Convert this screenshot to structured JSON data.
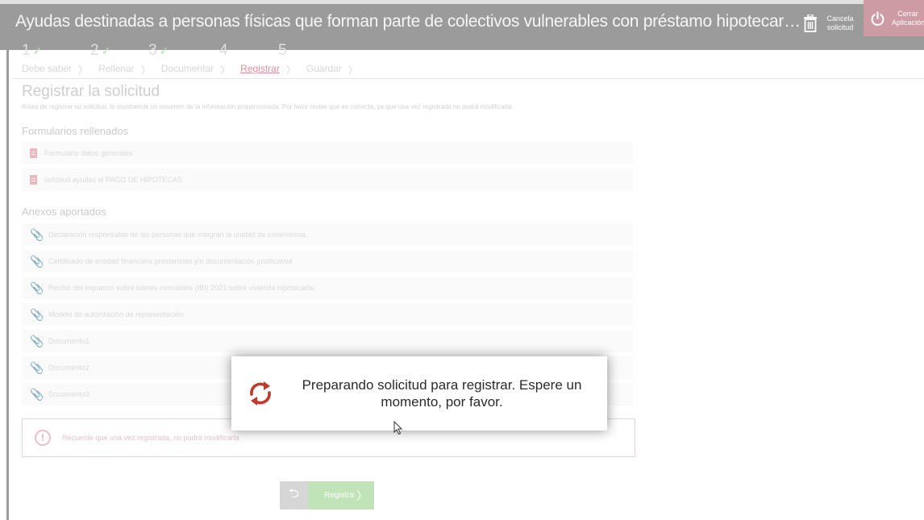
{
  "header": {
    "title": "Ayudas destinadas a personas físicas que forman parte de colectivos vulnerables con préstamo hipotecario sobre la vivienda habitual en régimen de ti...",
    "cancel_label": "Cancela solicitud",
    "close_label": "Cerrar Aplicación"
  },
  "steps": [
    {
      "number": "1",
      "label": "Debe saber",
      "done": true
    },
    {
      "number": "2",
      "label": "Rellenar",
      "done": true
    },
    {
      "number": "3",
      "label": "Documentar",
      "done": true
    },
    {
      "number": "4",
      "label": "Registrar",
      "done": false,
      "active": true
    },
    {
      "number": "5",
      "label": "Guardar",
      "done": false
    }
  ],
  "check_mark": "✓",
  "section": {
    "title": "Registrar la solicitud",
    "description": "Antes de registrar su solicitud, le mostramos un resumen de la información proporcionada. Por favor revise que es correcta, ya que una vez registrada no podrá modificarla."
  },
  "forms": {
    "title": "Formularios rellenados",
    "items": [
      "Formulario datos generales",
      "solicitud ayudas al PAGO DE HIPOTECAS"
    ]
  },
  "annexes": {
    "title": "Anexos aportados",
    "items": [
      "Declaración responsable de las personas que integran la unidad de convivencia.",
      "Certificado de entidad financiera prestamista y/o documentación justificativa",
      "Recibo del impuesto sobre bienes inmuebles (IBI) 2021 sobre vivienda hipotecada.",
      "Modelo de autorización de representación.",
      "Documento1",
      "Documento2",
      "Documento3"
    ]
  },
  "notice": {
    "icon_text": "!",
    "text": "Recuerde que una vez registrada, no podrá modificarla."
  },
  "actions": {
    "back_glyph": "⮌",
    "register_label": "Registra",
    "next_glyph": "〉"
  },
  "modal": {
    "message": "Preparando solicitud para registrar. Espere un momento, por favor."
  },
  "colors": {
    "accent": "#c0392b",
    "topbar": "#8a8a8a",
    "register_button": "#b5dfac"
  }
}
